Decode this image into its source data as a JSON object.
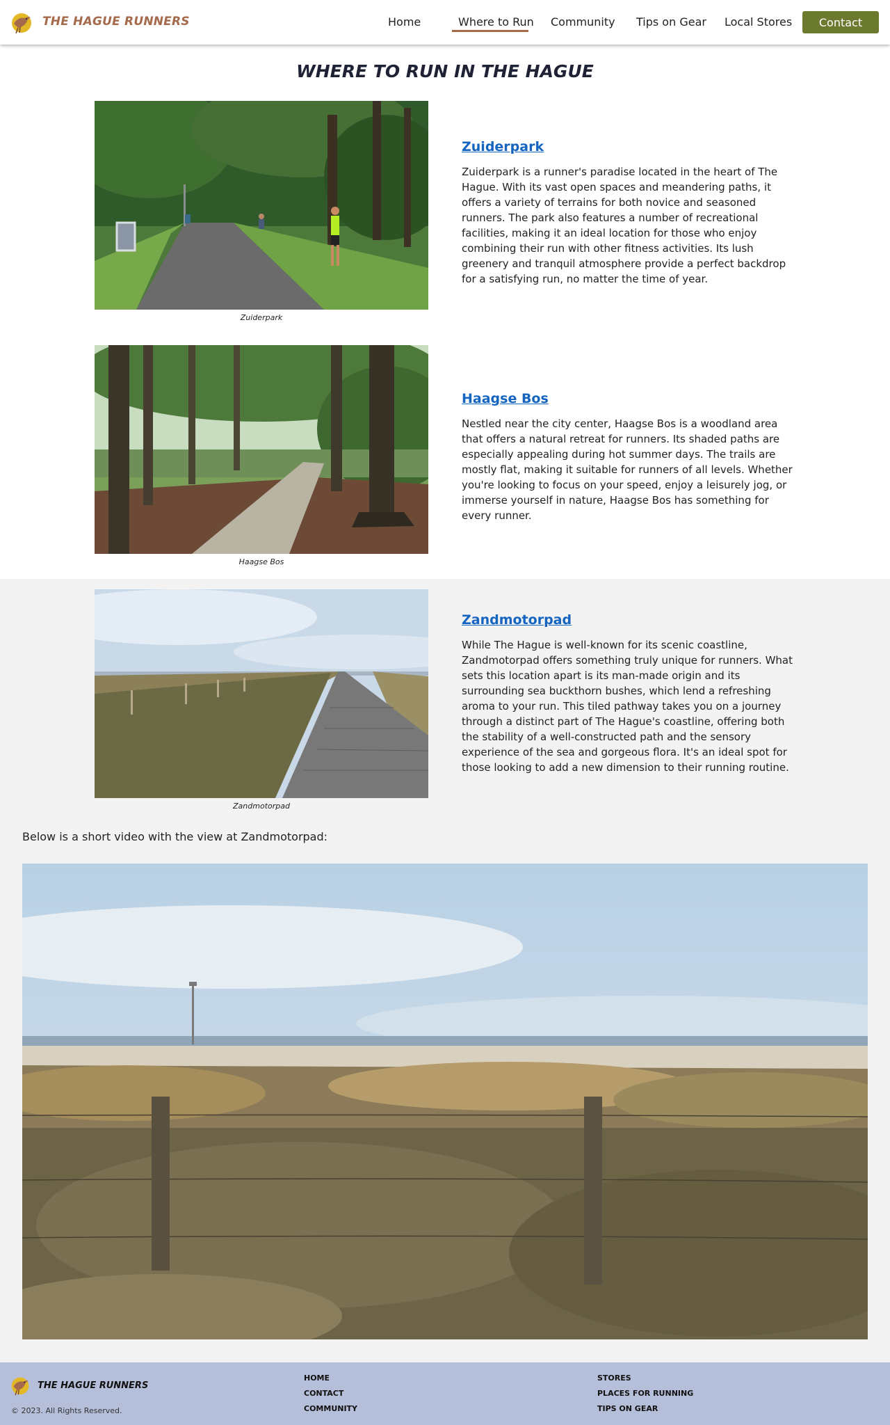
{
  "header": {
    "brand": "THE HAGUE RUNNERS",
    "nav": [
      "Home",
      "Where to Run",
      "Community",
      "Tips on Gear",
      "Local Stores"
    ],
    "active": "Where to Run",
    "contact_label": "Contact",
    "accent_color": "#a56a4c",
    "button_color": "#6b7a2e"
  },
  "page": {
    "title": "WHERE TO RUN IN THE HAGUE"
  },
  "locations": [
    {
      "name": "Zuiderpark",
      "caption": "Zuiderpark",
      "text": "Zuiderpark is a runner's paradise located in the heart of The Hague. With its vast open spaces and meandering paths, it offers a variety of terrains for both novice and seasoned runners. The park also features a number of recreational facilities, making it an ideal location for those who enjoy combining their run with other fitness activities. Its lush greenery and tranquil atmosphere provide a perfect backdrop for a satisfying run, no matter the time of year."
    },
    {
      "name": "Haagse Bos",
      "caption": "Haagse Bos",
      "text": "Nestled near the city center, Haagse Bos is a woodland area that offers a natural retreat for runners. Its shaded paths are especially appealing during hot summer days. The trails are mostly flat, making it suitable for runners of all levels. Whether you're looking to focus on your speed, enjoy a leisurely jog, or immerse yourself in nature, Haagse Bos has something for every runner."
    },
    {
      "name": "Zandmotorpad",
      "caption": "Zandmotorpad",
      "text": "While The Hague is well-known for its scenic coastline, Zandmotorpad offers something truly unique for runners. What sets this location apart is its man-made origin and its surrounding sea buckthorn bushes, which lend a refreshing aroma to your run. This tiled pathway takes you on a journey through a distinct part of The Hague's coastline, offering both the stability of a well-constructed path and the sensory experience of the sea and gorgeous flora. It's an ideal spot for those looking to add a new dimension to their running routine."
    }
  ],
  "video": {
    "intro": "Below is a short video with the view at Zandmotorpad:"
  },
  "footer": {
    "brand": "THE HAGUE RUNNERS",
    "copyright": "© 2023. All Rights Reserved.",
    "col1": [
      "HOME",
      "CONTACT",
      "COMMUNITY"
    ],
    "col2": [
      "STORES",
      "PLACES FOR RUNNING",
      "TIPS ON GEAR"
    ],
    "background": "#b6bfda"
  }
}
